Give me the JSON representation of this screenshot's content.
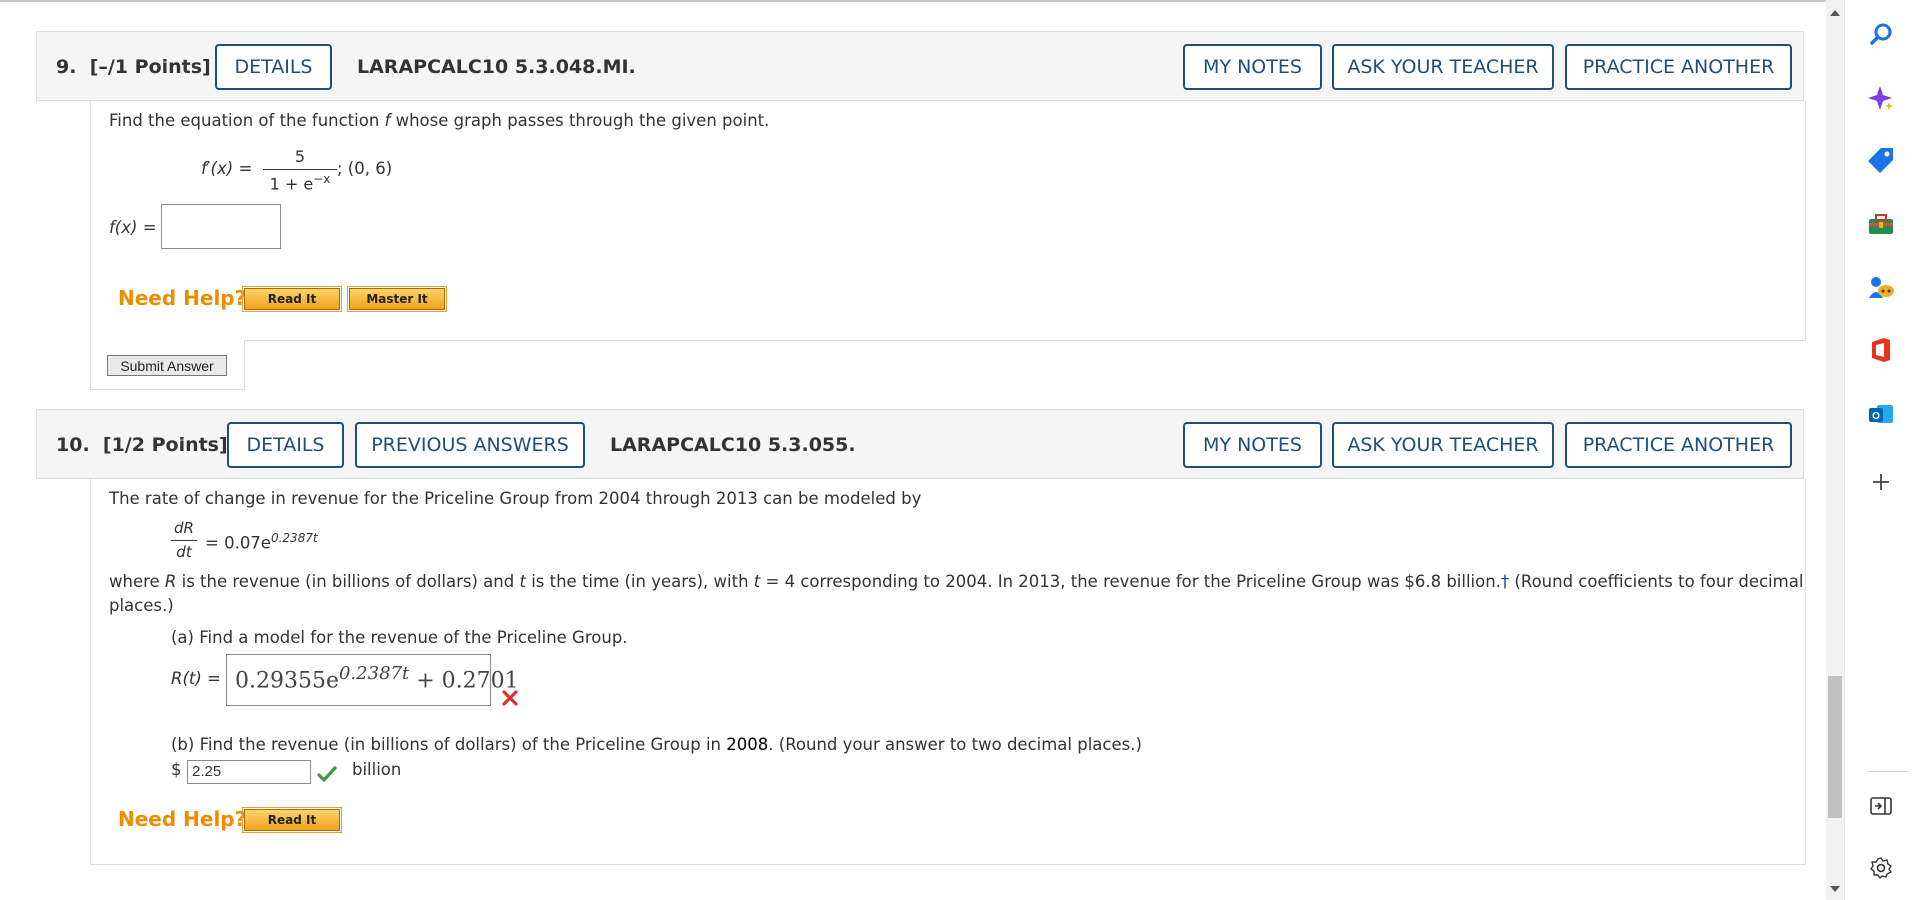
{
  "q9": {
    "number": "9.",
    "points": "[–/1 Points]",
    "details_label": "DETAILS",
    "code": "LARAPCALC10 5.3.048.MI.",
    "my_notes_label": "MY NOTES",
    "ask_teacher_label": "ASK YOUR TEACHER",
    "practice_label": "PRACTICE ANOTHER",
    "instruction_before_f": "Find the equation of the function ",
    "instruction_f": "f",
    "instruction_after_f": " whose graph passes through the given point.",
    "fprime_lhs": "f′(x) =",
    "fprime_num": "5",
    "fprime_den": "1 + e",
    "fprime_den_exp": "−x",
    "fprime_point": "; (0, 6)",
    "fx_label": "f(x) =",
    "fx_value": "",
    "need_help": "Need Help?",
    "read_it": "Read It",
    "master_it": "Master It",
    "submit_label": "Submit Answer"
  },
  "q10": {
    "number": "10.",
    "points": "[1/2 Points]",
    "details_label": "DETAILS",
    "previous_answers_label": "PREVIOUS ANSWERS",
    "code": "LARAPCALC10 5.3.055.",
    "my_notes_label": "MY NOTES",
    "ask_teacher_label": "ASK YOUR TEACHER",
    "practice_label": "PRACTICE ANOTHER",
    "intro": "The rate of change in revenue for the Priceline Group from 2004 through 2013 can be modeled by",
    "dr_num": "dR",
    "dr_den": "dt",
    "dr_rhs": "= 0.07e",
    "dr_exp": "0.2387t",
    "where_1": "where ",
    "where_R": "R",
    "where_2": " is the revenue (in billions of dollars) and ",
    "where_t": "t",
    "where_3": " is the time (in years), with ",
    "where_t2": "t",
    "where_4": " = 4 corresponding to 2004. In 2013, the revenue for the Priceline Group was $6.8 billion.",
    "dagger": "†",
    "where_5": " (Round coefficients to four decimal",
    "where_line2": "places.)",
    "part_a": "(a) Find a model for the revenue of the Priceline Group.",
    "rt_label": "R(t) =",
    "rt_coef": "0.29355e",
    "rt_exp": "0.2387t",
    "rt_tail": "+ 0.2701",
    "part_a_status": "incorrect",
    "part_b_1": "(b) Find the revenue (in billions of dollars) of the Priceline Group in ",
    "part_b_year": "2008",
    "part_b_2": ". (Round your answer to two decimal places.)",
    "dollar": "$",
    "part_b_value": "2.25",
    "part_b_unit": "billion",
    "part_b_status": "correct",
    "need_help": "Need Help?",
    "read_it": "Read It"
  },
  "sidebar": {
    "icons": [
      "search-icon",
      "copilot-icon",
      "shopping-tag-icon",
      "tools-icon",
      "games-icon",
      "office-icon",
      "outlook-icon",
      "add-icon",
      "sidebar-toggle-icon",
      "settings-icon"
    ]
  },
  "colors": {
    "accent": "#1f4e79",
    "help_orange": "#f08c00",
    "incorrect_red": "#e03030",
    "correct_green": "#3a9a3a"
  }
}
